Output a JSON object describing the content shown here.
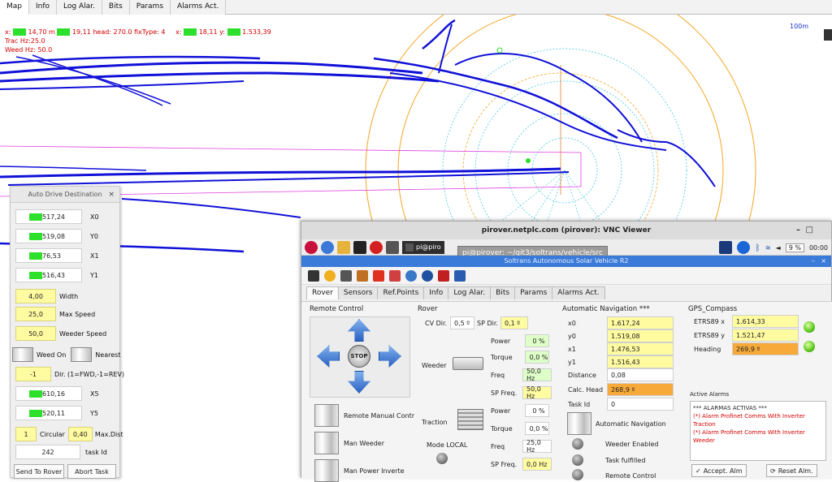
{
  "tabs": [
    "Map",
    "Info",
    "Log Alar.",
    "Bits",
    "Params",
    "Alarms Act."
  ],
  "map": {
    "status_line1_a": "x:",
    "status_line1_b": "14,70 m",
    "status_line1_c": "19,11 head: 270.0 fixType: 4",
    "status_line1_d": "x:",
    "status_line1_e": "18,11 y:",
    "status_line1_f": "1.533,39",
    "trac_hz": "Trac Hz:25.0",
    "weed_hz": "Weed Hz: 50.0",
    "scale": "100m"
  },
  "auto_drive": {
    "title": "Auto Drive Destination",
    "x0": "517,24",
    "x0_label": "X0",
    "y0": "519,08",
    "y0_label": "Y0",
    "x1": "76,53",
    "x1_label": "X1",
    "y1": "516,43",
    "y1_label": "Y1",
    "width": "4,00",
    "width_label": "Width",
    "max_speed": "25,0",
    "max_speed_label": "Max Speed",
    "weeder_speed": "50,0",
    "weeder_speed_label": "Weeder Speed",
    "weed_on_label": "Weed On",
    "nearest_label": "Nearest",
    "dir": "-1",
    "dir_label": "Dir. (1=FWD,-1=REV)",
    "x5": "610,16",
    "x5_label": "X5",
    "y5": "520,11",
    "y5_label": "Y5",
    "circular": "1",
    "circular_label": "Circular",
    "max_dist": "0,40",
    "max_dist_label": "Max.Dist",
    "task_id": "242",
    "task_id_label": "task Id",
    "send_label": "Send To Rover",
    "abort_label": "Abort Task"
  },
  "vnc": {
    "title": "pirover.netplc.com (pirover): VNC Viewer",
    "term_label": "pi@piro",
    "tooltip": "pi@pirover: ~/git3/soltrans/vehicle/src",
    "cpu": "9 %",
    "clock": "00:00",
    "app_title": "Soltrans Autonomous Solar Vehicle R2",
    "tabs": [
      "Rover",
      "Sensors",
      "Ref.Points",
      "Info",
      "Log Alar.",
      "Bits",
      "Params",
      "Alarms Act."
    ],
    "remote_control_title": "Remote Control",
    "stop_label": "STOP",
    "remote_manual": "Remote Manual Contr",
    "man_weeder": "Man Weeder",
    "man_power": "Man Power Inverte",
    "rover_title": "Rover",
    "cv_dir_label": "CV Dir.",
    "cv_dir": "0,5 º",
    "sp_dir_label": "SP Dir.",
    "sp_dir": "0,1 º",
    "weeder_label": "Weeder",
    "power_label": "Power",
    "weeder_power": "0 %",
    "torque_label": "Torque",
    "weeder_torque": "0,0 %",
    "freq_label": "Freq",
    "weeder_freq": "50,0 Hz",
    "sp_freq_label": "SP Freq.",
    "weeder_sp_freq": "50,0 Hz",
    "traction_label": "Traction",
    "traction_power": "0 %",
    "traction_torque": "0,0 %",
    "mode_label": "Mode LOCAL",
    "traction_freq": "25,0 Hz",
    "traction_sp_freq": "0,0 Hz",
    "autonav_title": "Automatic Navigation ***",
    "x0_label": "x0",
    "x0": "1.617,24",
    "y0_label": "y0",
    "y0": "1.519,08",
    "x1_label": "x1",
    "x1": "1.476,53",
    "y1_label": "y1",
    "y1": "1.516,43",
    "distance_label": "Distance",
    "distance": "0,08",
    "calc_head_label": "Calc. Head",
    "calc_head": "268,9 º",
    "task_id_label": "Task Id",
    "task_id": "0",
    "auto_nav_btn": "Automatic Navigation",
    "weeder_enabled": "Weeder Enabled",
    "task_fulfilled": "Task fulfilled",
    "remote_control": "Remote Control",
    "gps_title": "GPS_Compass",
    "etrs_x_label": "ETRS89 x",
    "etrs_x": "1.614,33",
    "etrs_y_label": "ETRS89 y",
    "etrs_y": "1.521,47",
    "heading_label": "Heading",
    "heading": "269,9 º",
    "active_alarms_title": "Active Alarms",
    "alarm_header": "*** ALARMAS ACTIVAS ***",
    "alarm1": "(*) Alarm Profinet Comms With Inverter Traction",
    "alarm2": "(*) Alarm Profinet Comms With Inverter Weeder",
    "accept_label": "Accept. Alm",
    "reset_label": "Reset Alm."
  }
}
